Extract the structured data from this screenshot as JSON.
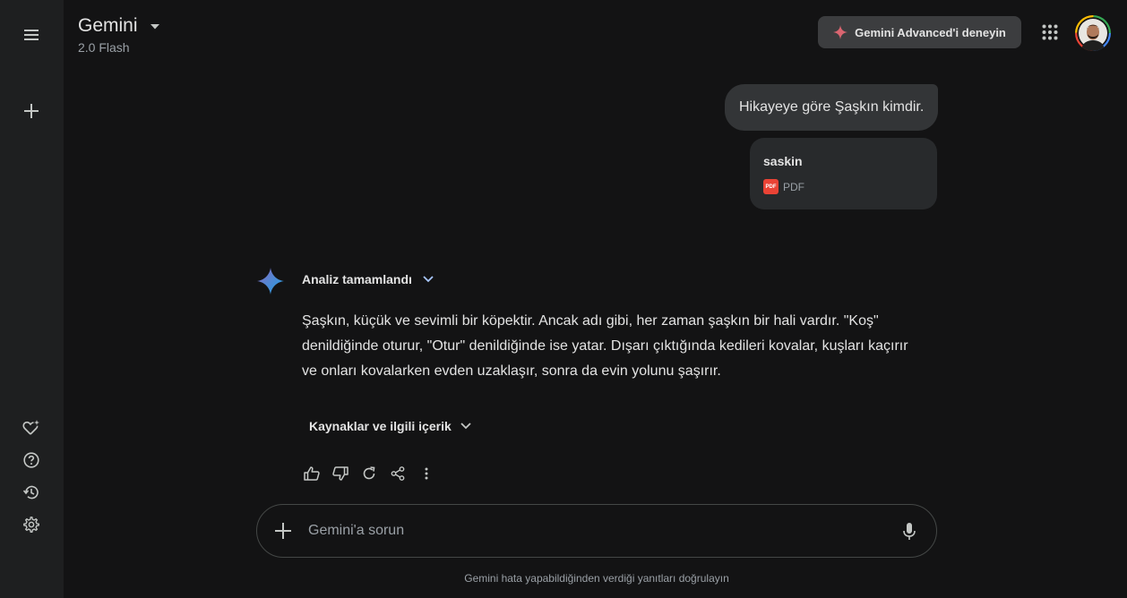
{
  "header": {
    "app_title": "Gemini",
    "model": "2.0 Flash",
    "try_advanced_label": "Gemini Advanced'i deneyin"
  },
  "sidebar": {
    "items": [
      {
        "icon": "menu-icon"
      },
      {
        "icon": "new-chat-icon"
      },
      {
        "icon": "gem-manager-icon"
      },
      {
        "icon": "help-icon"
      },
      {
        "icon": "activity-icon"
      },
      {
        "icon": "settings-icon"
      }
    ]
  },
  "conversation": {
    "user_message": "Hikayeye göre Şaşkın kimdir.",
    "attachment": {
      "name": "saskin",
      "type_badge": "PDF",
      "type_label": "PDF"
    },
    "analysis_label": "Analiz tamamlandı",
    "response_lines": [
      "Şaşkın, küçük ve sevimli bir köpektir. Ancak adı gibi, her zaman şaşkın bir hali vardır. \"Koş\"",
      "denildiğinde oturur, \"Otur\" denildiğinde ise yatar. Dışarı çıktığında kedileri kovalar, kuşları kaçırır",
      "ve onları kovalarken evden uzaklaşır, sonra da evin yolunu şaşırır."
    ],
    "sources_label": "Kaynaklar ve ilgili içerik"
  },
  "input": {
    "placeholder": "Gemini'a sorun"
  },
  "footer": {
    "disclaimer": "Gemini hata yapabildiğinden verdiği yanıtları doğrulayın"
  },
  "colors": {
    "background": "#131314",
    "sidebar": "#1e1f20",
    "accent_blue": "#4796e3",
    "pdf_red": "#ea4335"
  }
}
